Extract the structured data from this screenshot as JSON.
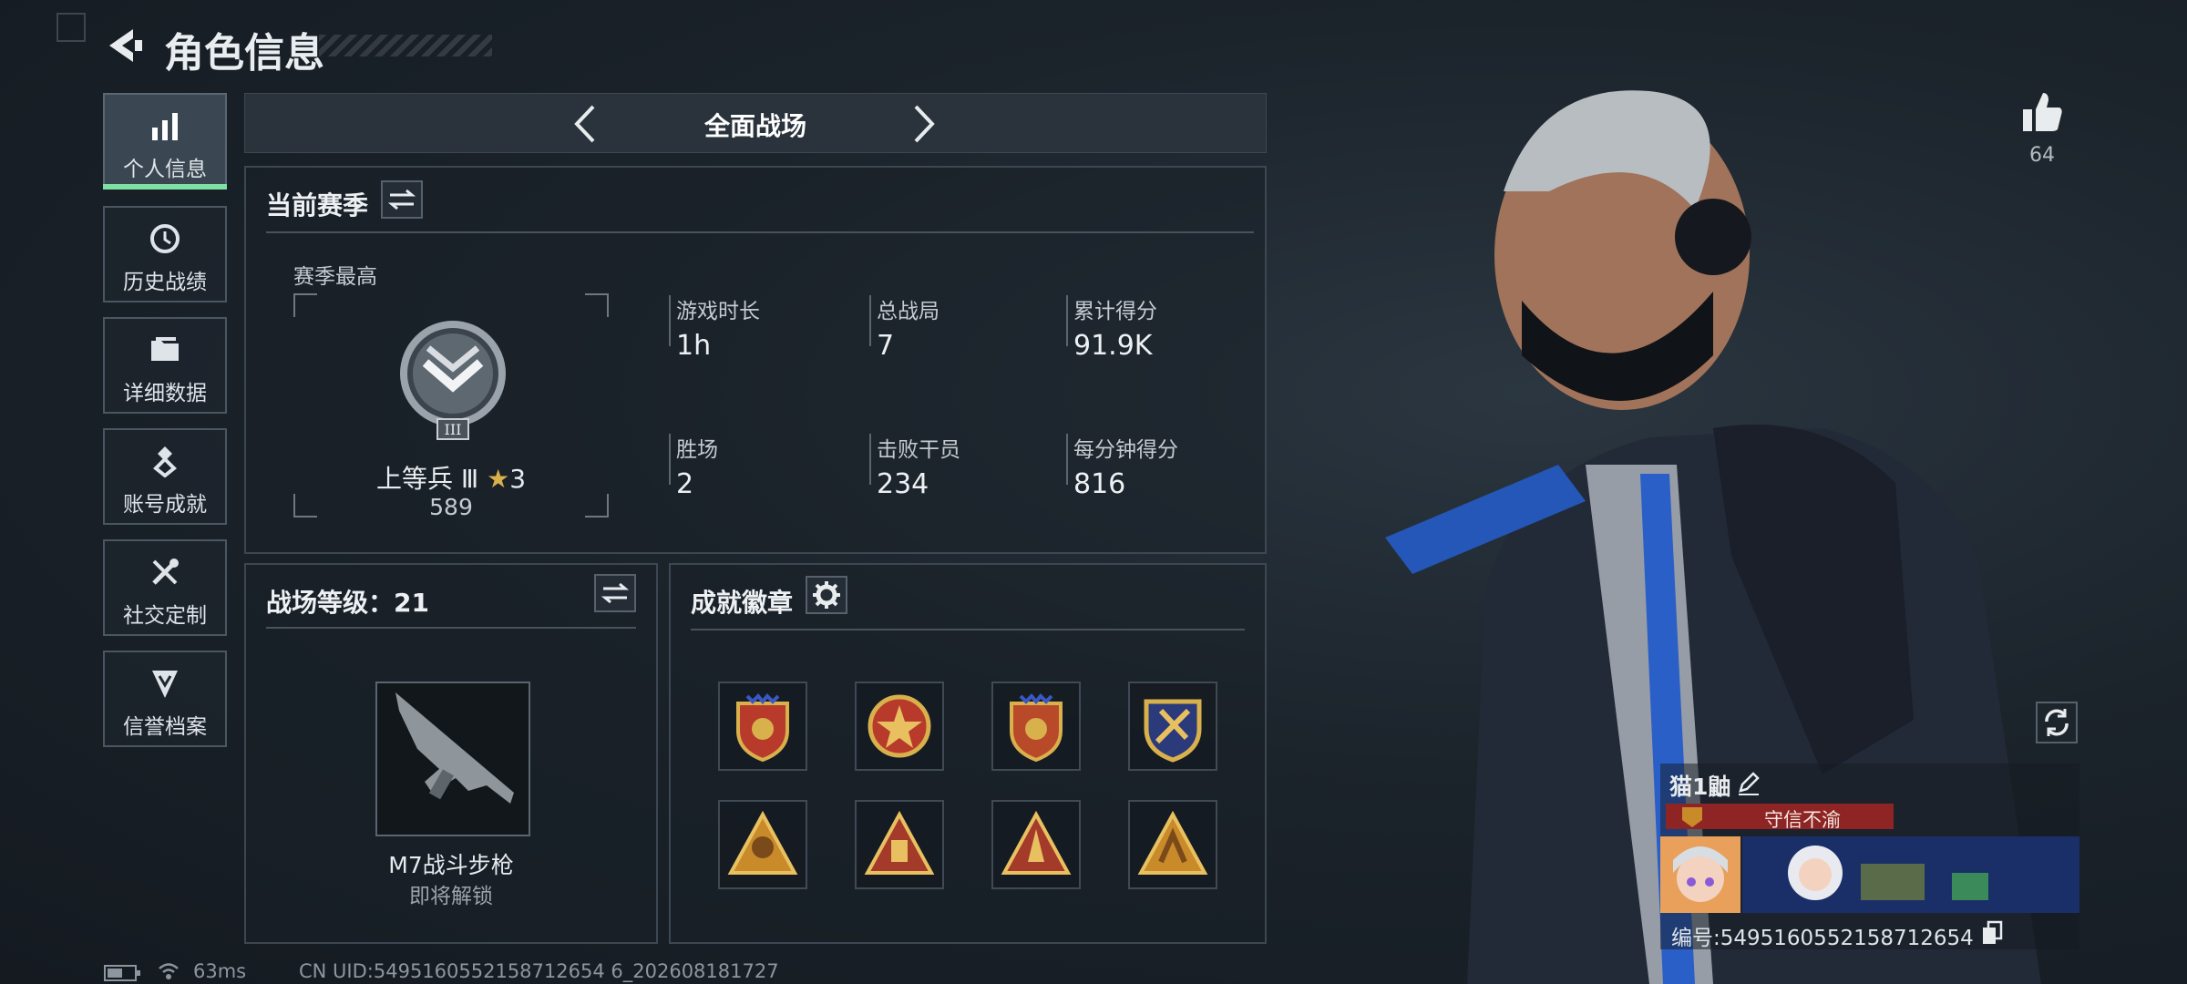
{
  "header": {
    "title": "角色信息"
  },
  "sidebar": {
    "items": [
      {
        "label": "个人信息",
        "icon": "bar-chart-icon"
      },
      {
        "label": "历史战绩",
        "icon": "history-icon"
      },
      {
        "label": "详细数据",
        "icon": "folder-icon"
      },
      {
        "label": "账号成就",
        "icon": "achievement-icon"
      },
      {
        "label": "社交定制",
        "icon": "tools-icon"
      },
      {
        "label": "信誉档案",
        "icon": "shield-icon"
      }
    ]
  },
  "mode_selector": {
    "label": "全面战场"
  },
  "season": {
    "title": "当前赛季",
    "best_label": "赛季最高",
    "rank_name": "上等兵 Ⅲ",
    "rank_stars": "3",
    "rank_points": "589",
    "stats": [
      {
        "label": "游戏时长",
        "value": "1h"
      },
      {
        "label": "总战局",
        "value": "7"
      },
      {
        "label": "累计得分",
        "value": "91.9K"
      },
      {
        "label": "胜场",
        "value": "2"
      },
      {
        "label": "击败干员",
        "value": "234"
      },
      {
        "label": "每分钟得分",
        "value": "816"
      }
    ]
  },
  "battle_level": {
    "title": "战场等级：21",
    "weapon_name": "M7战斗步枪",
    "weapon_status": "即将解锁"
  },
  "badges": {
    "title": "成就徽章"
  },
  "likes": {
    "count": "64"
  },
  "profile": {
    "name": "猫1鼬",
    "title_tag": "守信不渝",
    "id_text": "编号:5495160552158712654"
  },
  "footer": {
    "ping": "63ms",
    "uid": "CN UID:5495160552158712654 6_202608181727"
  },
  "colors": {
    "accent": "#7ee0a5",
    "title_tag_bg": "#8e2424"
  }
}
